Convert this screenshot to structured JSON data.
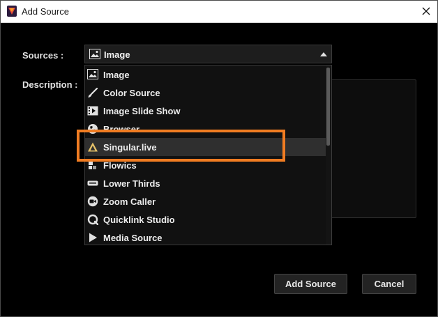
{
  "window": {
    "title": "Add Source",
    "close_icon": "close-icon",
    "app_icon": "vmix-app-icon"
  },
  "form": {
    "sources_label": "Sources :",
    "description_label": "Description :",
    "selected_source": "Image",
    "selected_source_icon": "image-icon"
  },
  "dropdown": {
    "items": [
      {
        "label": "Image",
        "icon": "image-icon"
      },
      {
        "label": "Color Source",
        "icon": "brush-icon"
      },
      {
        "label": "Image Slide Show",
        "icon": "slideshow-icon"
      },
      {
        "label": "Browser",
        "icon": "globe-icon"
      },
      {
        "label": "Singular.live",
        "icon": "singular-icon",
        "selected": true
      },
      {
        "label": "Flowics",
        "icon": "flowics-icon"
      },
      {
        "label": "Lower Thirds",
        "icon": "name-tag-icon"
      },
      {
        "label": "Zoom Caller",
        "icon": "zoom-icon"
      },
      {
        "label": "Quicklink Studio",
        "icon": "quicklink-icon"
      },
      {
        "label": "Media Source",
        "icon": "play-icon"
      }
    ]
  },
  "buttons": {
    "add_source": "Add Source",
    "cancel": "Cancel"
  },
  "colors": {
    "highlight": "#f07c22",
    "background": "#000000",
    "titlebar": "#ffffff"
  }
}
